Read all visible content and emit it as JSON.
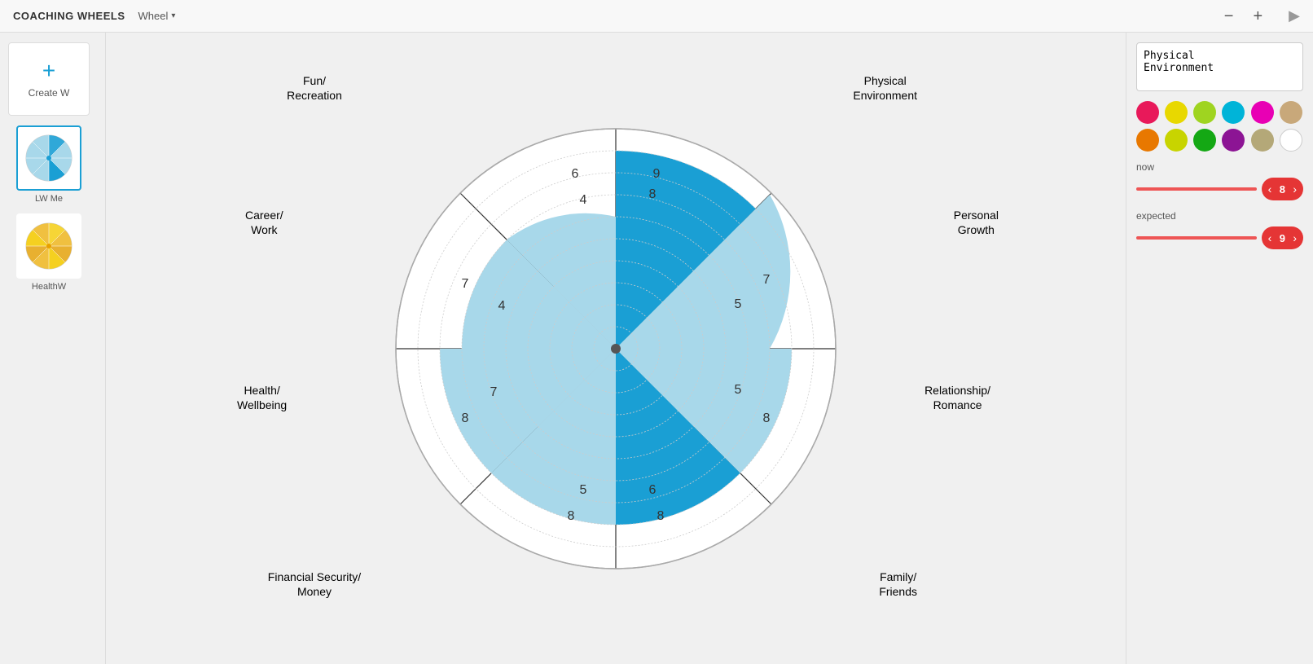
{
  "topbar": {
    "title": "COACHING WHEELS",
    "wheel_menu": "Wheel",
    "zoom_minus": "−",
    "zoom_plus": "+"
  },
  "sidebar": {
    "create_label": "Create W",
    "wheel1_label": "LW Me",
    "wheel2_label": "HealthW"
  },
  "right_panel": {
    "segment_name": "Physical\nEnvironment",
    "colors": [
      {
        "name": "hot-pink",
        "hex": "#e8195a"
      },
      {
        "name": "yellow",
        "hex": "#e8d800"
      },
      {
        "name": "yellow-green",
        "hex": "#9fd420"
      },
      {
        "name": "cyan",
        "hex": "#00b4d8"
      },
      {
        "name": "magenta",
        "hex": "#e800b4"
      },
      {
        "name": "tan",
        "hex": "#c8a87a"
      },
      {
        "name": "orange",
        "hex": "#e87800"
      },
      {
        "name": "lime-yellow",
        "hex": "#c8d400"
      },
      {
        "name": "green",
        "hex": "#14a814"
      },
      {
        "name": "purple",
        "hex": "#8c1494"
      },
      {
        "name": "khaki",
        "hex": "#b4a878"
      },
      {
        "name": "white",
        "hex": "#ffffff"
      }
    ],
    "now_label": "now",
    "now_value": "8",
    "expected_label": "expected",
    "expected_value": "9"
  },
  "wheel": {
    "segments": [
      {
        "label": "Physical\nEnvironment",
        "now": 9,
        "expected": 8,
        "color": "#1a9fd4",
        "angle_start": -90,
        "angle_end": -45
      },
      {
        "label": "Personal\nGrowth",
        "now": 7,
        "expected": 5,
        "color": "#a8d8ea",
        "angle_start": -45,
        "angle_end": 0
      },
      {
        "label": "Relationship/\nRomance",
        "now": 8,
        "expected": 5,
        "color": "#a8d8ea",
        "angle_start": 0,
        "angle_end": 45
      },
      {
        "label": "Family/\nFriends",
        "now": 8,
        "expected": 6,
        "color": "#1a9fd4",
        "angle_start": 45,
        "angle_end": 90
      },
      {
        "label": "Financial Security/\nMoney",
        "now": 8,
        "expected": 5,
        "color": "#a8d8ea",
        "angle_start": 90,
        "angle_end": 135
      },
      {
        "label": "Health/\nWellbeing",
        "now": 8,
        "expected": 7,
        "color": "#a8d8ea",
        "angle_start": 135,
        "angle_end": 180
      },
      {
        "label": "Career/\nWork",
        "now": 7,
        "expected": 4,
        "color": "#a8d8ea",
        "angle_start": 180,
        "angle_end": 225
      },
      {
        "label": "Fun/\nRecreation",
        "now": 6,
        "expected": 4,
        "color": "#a8d8ea",
        "angle_start": 225,
        "angle_end": 270
      }
    ]
  }
}
